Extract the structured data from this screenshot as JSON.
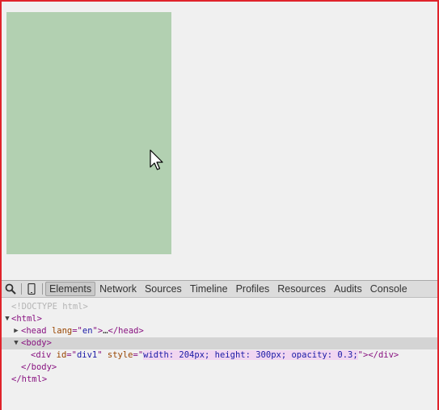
{
  "page": {
    "div1_color": "#b2d0b1",
    "frame_color": "#e0232b"
  },
  "devtools": {
    "toolbar_icons": [
      "search-icon",
      "device-mode-icon"
    ],
    "tabs": [
      {
        "label": "Elements",
        "active": true
      },
      {
        "label": "Network",
        "active": false
      },
      {
        "label": "Sources",
        "active": false
      },
      {
        "label": "Timeline",
        "active": false
      },
      {
        "label": "Profiles",
        "active": false
      },
      {
        "label": "Resources",
        "active": false
      },
      {
        "label": "Audits",
        "active": false
      },
      {
        "label": "Console",
        "active": false
      }
    ],
    "dom": {
      "doctype": "<!DOCTYPE html>",
      "html_open": "<html>",
      "head_open_tag": "<head",
      "head_attr_name": "lang",
      "head_attr_eq": "=\"",
      "head_attr_value": "en",
      "head_attr_close": "\">",
      "head_ellipsis": "…",
      "head_close": "</head>",
      "body_open": "<body>",
      "div_open": "<div",
      "div_id_name": "id",
      "div_id_eq": "=\"",
      "div_id_value": "div1",
      "div_id_close": "\"",
      "div_style_name": "style",
      "div_style_eq": "=\"",
      "div_style_value": "width: 204px; height: 300px; opacity: 0.3;",
      "div_style_close": "\">",
      "div_close": "</div>",
      "body_close": "</body>",
      "html_close": "</html>",
      "arrow_expanded": "▼",
      "arrow_collapsed": "▶"
    }
  }
}
